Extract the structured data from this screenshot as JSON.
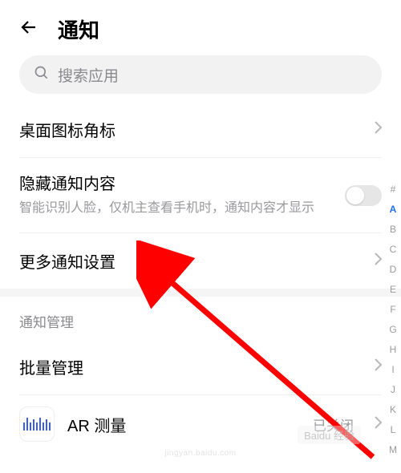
{
  "header": {
    "title": "通知"
  },
  "search": {
    "placeholder": "搜索应用"
  },
  "rows": {
    "badge": "桌面图标角标",
    "hide": {
      "title": "隐藏通知内容",
      "sub": "智能识别人脸，仅机主查看手机时，通知内容才显示"
    },
    "more": "更多通知设置"
  },
  "section": {
    "management": "通知管理",
    "batch": "批量管理"
  },
  "app": {
    "name": "AR 测量",
    "status": "已关闭"
  },
  "alpha": [
    "#",
    "A",
    "B",
    "C",
    "D",
    "E",
    "F",
    "G",
    "H",
    "I",
    "J",
    "K",
    "L",
    "M"
  ],
  "alpha_active": "A",
  "watermark_text": "jingyan.baidu.com",
  "badge_text": "Baidu 经验"
}
